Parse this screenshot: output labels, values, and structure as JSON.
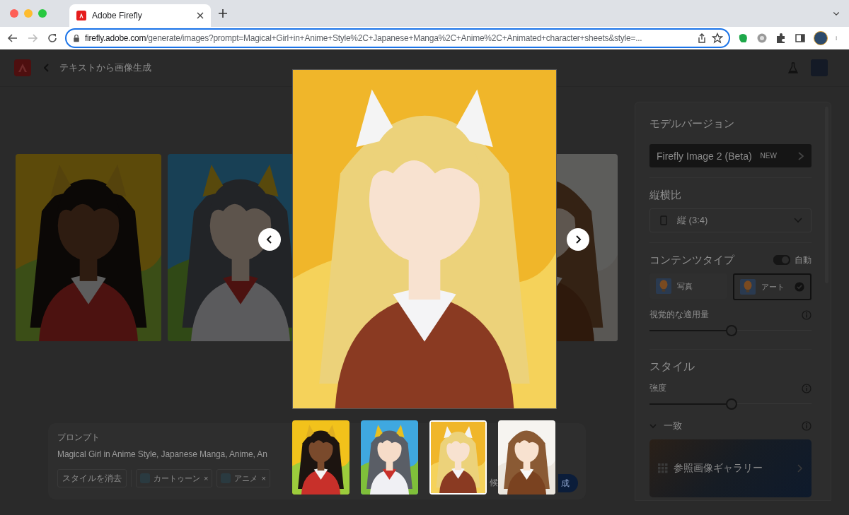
{
  "browser": {
    "tab": {
      "title": "Adobe Firefly",
      "selected": true
    },
    "url": {
      "host": "firefly.adobe.com",
      "path": "/generate/images?prompt=Magical+Girl+in+Anime+Style%2C+Japanese+Manga%2C+Anime%2C+Animated+character+sheets&style=..."
    }
  },
  "header": {
    "title": "テキストから画像生成"
  },
  "prompt": {
    "label": "プロンプト",
    "value": "Magical Girl in Anime Style, Japanese Manga, Anime, An",
    "clear_button": "スタイルを消去",
    "chips": [
      {
        "label": "カートゥーン",
        "remove": "×"
      },
      {
        "label": "アニメ",
        "remove": "×"
      }
    ],
    "hint_fragment": "候",
    "generate_button": "成"
  },
  "settings": {
    "model": {
      "heading": "モデルバージョン",
      "value": "Firefly Image 2 (Beta)",
      "badge": "NEW"
    },
    "aspect": {
      "heading": "縦横比",
      "value": "縦 (3:4)"
    },
    "content_type": {
      "heading": "コンテンツタイプ",
      "auto": {
        "label": "自動",
        "on": true
      },
      "options": [
        {
          "label": "写真",
          "selected": false
        },
        {
          "label": "アート",
          "selected": true
        }
      ],
      "visual_intensity": {
        "label": "視覚的な適用量",
        "level": 0.5
      }
    },
    "style": {
      "heading": "スタイル",
      "strength": {
        "label": "強度",
        "level": 0.5
      },
      "match": {
        "label": "一致",
        "expanded": true,
        "gallery_button": "参照画像ギャラリー"
      }
    }
  },
  "viewer": {
    "thumbnails": [
      {
        "selected": false
      },
      {
        "selected": false
      },
      {
        "selected": true
      },
      {
        "selected": false
      }
    ]
  }
}
